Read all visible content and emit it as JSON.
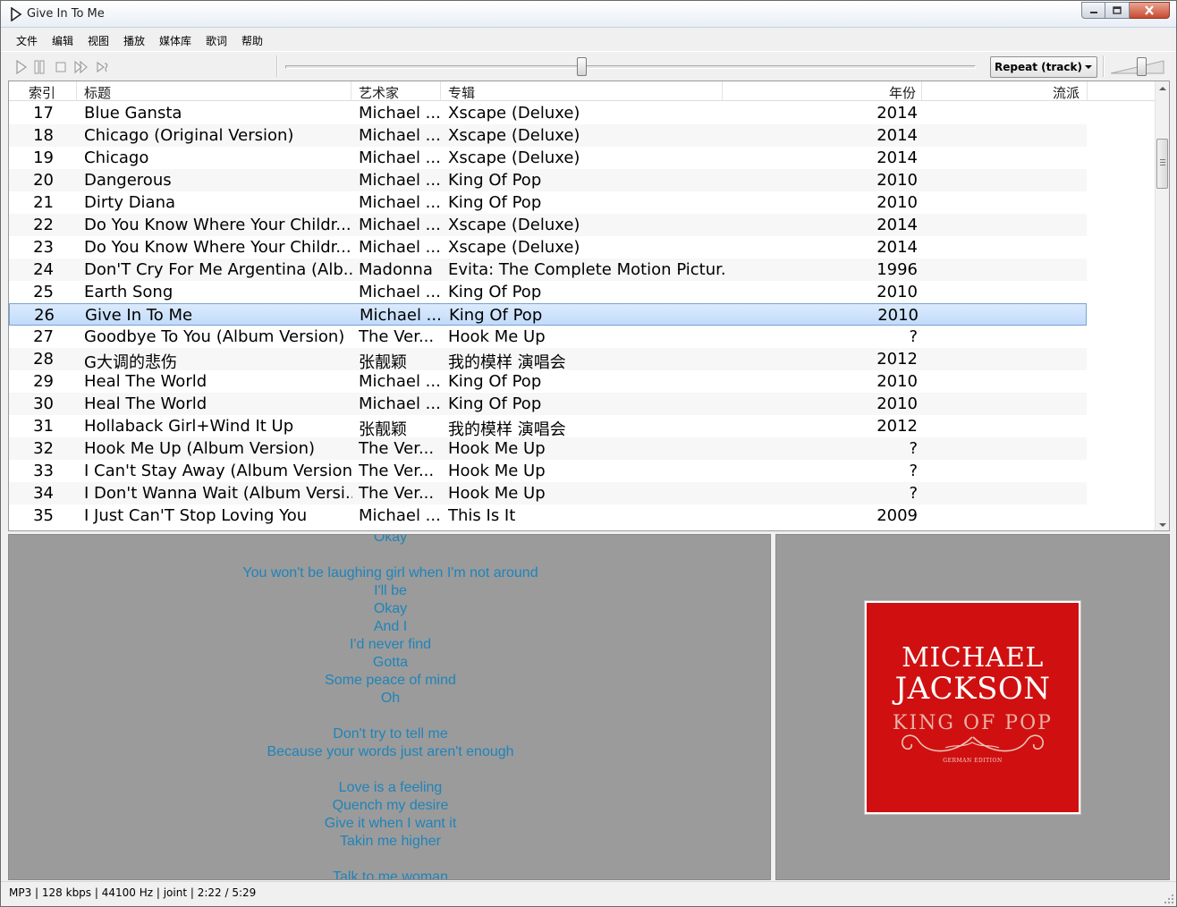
{
  "window": {
    "title": "Give In To Me"
  },
  "menu": [
    "文件",
    "编辑",
    "视图",
    "播放",
    "媒体库",
    "歌词",
    "帮助"
  ],
  "toolbar": {
    "repeat_mode": "Repeat (track)",
    "seek_progress": 0.42,
    "volume_level": 0.65
  },
  "playlist": {
    "columns": [
      "索引",
      "标题",
      "艺术家",
      "专辑",
      "年份",
      "流派"
    ],
    "selected_index": "26",
    "rows": [
      {
        "index": "17",
        "title": "Blue Gansta",
        "artist": "Michael ...",
        "album": "Xscape (Deluxe)",
        "year": "2014",
        "genre": ""
      },
      {
        "index": "18",
        "title": "Chicago (Original Version)",
        "artist": "Michael ...",
        "album": "Xscape (Deluxe)",
        "year": "2014",
        "genre": ""
      },
      {
        "index": "19",
        "title": "Chicago",
        "artist": "Michael ...",
        "album": "Xscape (Deluxe)",
        "year": "2014",
        "genre": ""
      },
      {
        "index": "20",
        "title": "Dangerous",
        "artist": "Michael ...",
        "album": "King Of Pop",
        "year": "2010",
        "genre": ""
      },
      {
        "index": "21",
        "title": "Dirty Diana",
        "artist": "Michael ...",
        "album": "King Of Pop",
        "year": "2010",
        "genre": ""
      },
      {
        "index": "22",
        "title": "Do You Know Where Your Childr...",
        "artist": "Michael ...",
        "album": "Xscape (Deluxe)",
        "year": "2014",
        "genre": ""
      },
      {
        "index": "23",
        "title": "Do You Know Where Your Childr...",
        "artist": "Michael ...",
        "album": "Xscape (Deluxe)",
        "year": "2014",
        "genre": ""
      },
      {
        "index": "24",
        "title": "Don'T Cry For Me Argentina (Alb...",
        "artist": "Madonna",
        "album": "Evita: The Complete Motion Pictur...",
        "year": "1996",
        "genre": ""
      },
      {
        "index": "25",
        "title": "Earth Song",
        "artist": "Michael ...",
        "album": "King Of Pop",
        "year": "2010",
        "genre": ""
      },
      {
        "index": "26",
        "title": "Give In To Me",
        "artist": "Michael ...",
        "album": "King Of Pop",
        "year": "2010",
        "genre": ""
      },
      {
        "index": "27",
        "title": "Goodbye To You (Album Version)",
        "artist": "The Ver...",
        "album": "Hook Me Up",
        "year": "?",
        "genre": ""
      },
      {
        "index": "28",
        "title": "G大调的悲伤",
        "artist": "张靓颖",
        "album": "我的模样 演唱会",
        "year": "2012",
        "genre": ""
      },
      {
        "index": "29",
        "title": "Heal The World",
        "artist": "Michael ...",
        "album": "King Of Pop",
        "year": "2010",
        "genre": ""
      },
      {
        "index": "30",
        "title": "Heal The World",
        "artist": "Michael ...",
        "album": "King Of Pop",
        "year": "2010",
        "genre": ""
      },
      {
        "index": "31",
        "title": "Hollaback Girl+Wind It Up",
        "artist": "张靓颖",
        "album": "我的模样 演唱会",
        "year": "2012",
        "genre": ""
      },
      {
        "index": "32",
        "title": "Hook Me Up (Album Version)",
        "artist": "The Ver...",
        "album": "Hook Me Up",
        "year": "?",
        "genre": ""
      },
      {
        "index": "33",
        "title": "I Can't Stay Away (Album Version)",
        "artist": "The Ver...",
        "album": "Hook Me Up",
        "year": "?",
        "genre": ""
      },
      {
        "index": "34",
        "title": "I Don't Wanna Wait (Album Versi...",
        "artist": "The Ver...",
        "album": "Hook Me Up",
        "year": "?",
        "genre": ""
      },
      {
        "index": "35",
        "title": "I Just Can'T Stop Loving You",
        "artist": "Michael ...",
        "album": "This Is It",
        "year": "2009",
        "genre": ""
      }
    ]
  },
  "lyrics": {
    "color": "#1f84b9",
    "lines": [
      "Okay",
      "",
      "You won't be laughing girl when I'm not around",
      "I'll be",
      "Okay",
      "And I",
      "I'd never find",
      "Gotta",
      "Some peace of mind",
      "Oh",
      "",
      "Don't try to tell me",
      "Because your words just aren't enough",
      "",
      "Love is a feeling",
      "Quench my desire",
      "Give it when I want it",
      "Takin me higher",
      "",
      "Talk to me woman"
    ]
  },
  "album_art": {
    "line1": "MICHAEL",
    "line2": "JACKSON",
    "line3": "KING OF POP",
    "line4": "GERMAN EDITION",
    "background": "#d01010"
  },
  "status": {
    "text": "MP3 | 128 kbps | 44100 Hz | joint | 2:22 / 5:29"
  }
}
